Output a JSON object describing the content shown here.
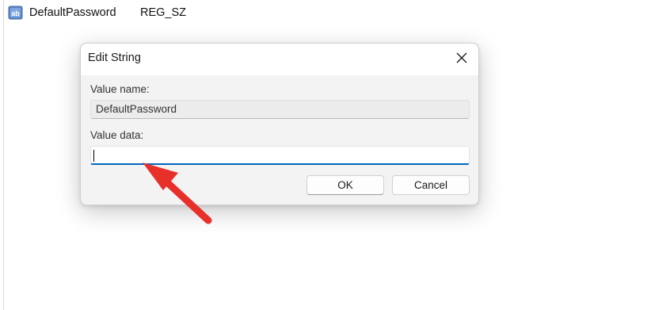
{
  "registry": {
    "value_name": "DefaultPassword",
    "value_type": "REG_SZ",
    "icon": "string-value-icon"
  },
  "dialog": {
    "title": "Edit String",
    "close_icon": "close-icon",
    "value_name_label": "Value name:",
    "value_name": "DefaultPassword",
    "value_data_label": "Value data:",
    "value_data": "",
    "ok_label": "OK",
    "cancel_label": "Cancel"
  },
  "annotation": {
    "arrow_icon": "red-arrow-icon",
    "color": "#e8302a"
  },
  "colors": {
    "accent": "#0067c0",
    "dialog_bg": "#f3f3f3"
  }
}
